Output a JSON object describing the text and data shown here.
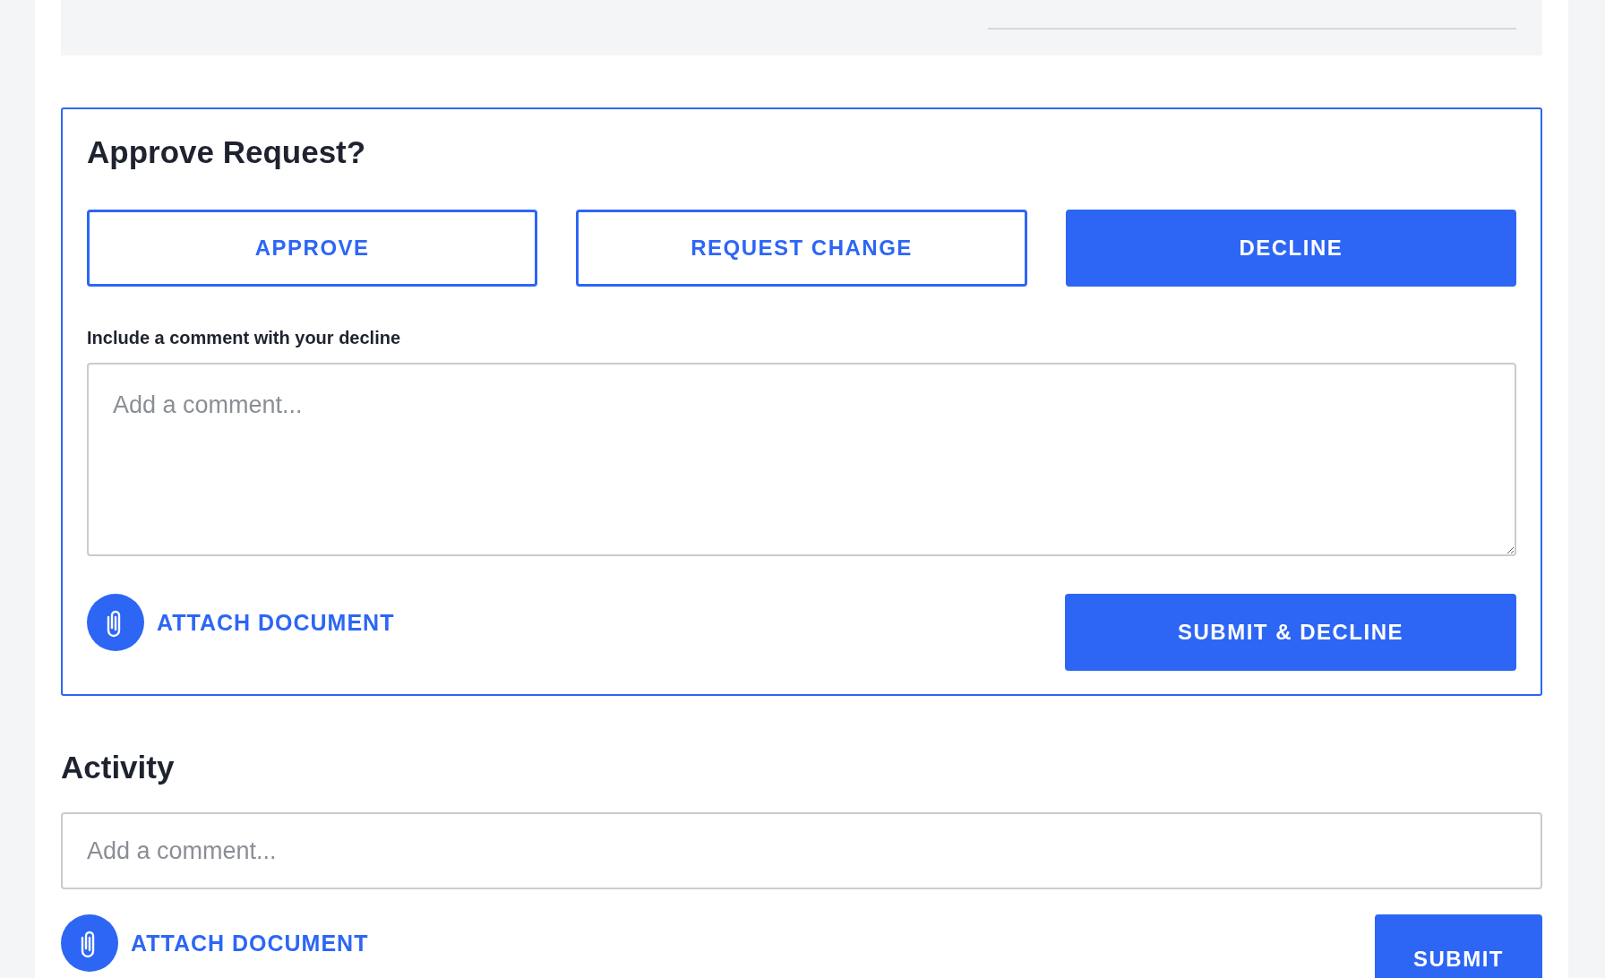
{
  "approval": {
    "title": "Approve Request?",
    "options": [
      {
        "label": "APPROVE",
        "selected": false
      },
      {
        "label": "REQUEST CHANGE",
        "selected": false
      },
      {
        "label": "DECLINE",
        "selected": true
      }
    ],
    "comment_label": "Include a comment with your decline",
    "comment": {
      "placeholder": "Add a comment..."
    },
    "attach": "ATTACH DOCUMENT",
    "submit": "SUBMIT & DECLINE"
  },
  "activity": {
    "title": "Activity",
    "comment": {
      "placeholder": "Add a comment..."
    },
    "attach": "ATTACH DOCUMENT",
    "submit": "SUBMIT"
  }
}
